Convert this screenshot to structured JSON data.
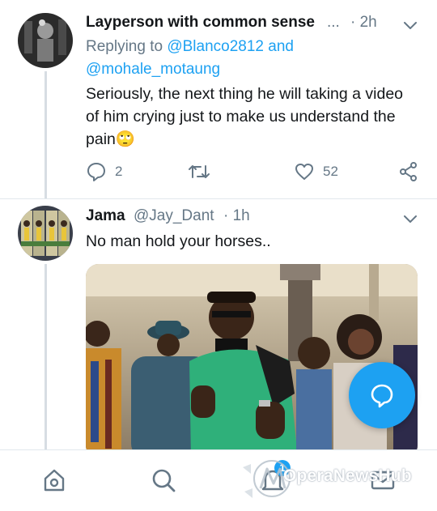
{
  "tweets": [
    {
      "author_name": "Layperson with common sense",
      "handle_truncation": "...",
      "time": "· 2h",
      "replying_prefix": "Replying to",
      "replying_to": [
        "@Blanco2812",
        "@mohale_motaung"
      ],
      "replying_joiner": "and",
      "text": "Seriously, the next thing he will taking a video of him crying just to make us understand the pain",
      "emoji": "🙄",
      "reply_count": "2",
      "retweet_count": "",
      "like_count": "52"
    },
    {
      "author_name": "Jama",
      "handle": "@Jay_Dant",
      "time": "· 1h",
      "text": "No man hold your horses.."
    }
  ],
  "fab": {
    "icon": "compose-reply-icon"
  },
  "bottom_nav": {
    "items": [
      "home-icon",
      "search-icon",
      "notifications-icon",
      "messages-icon"
    ],
    "notification_badge": "1"
  },
  "watermark": {
    "text": "OperaNewsHub"
  },
  "colors": {
    "accent": "#1da1f2",
    "secondary_text": "#657786",
    "thread_line": "#d7dde3"
  }
}
